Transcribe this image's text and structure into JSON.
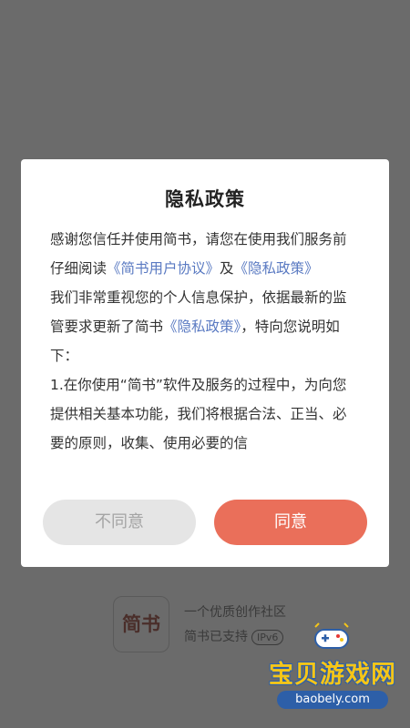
{
  "dialog": {
    "title": "隐私政策",
    "para1_a": "感谢您信任并使用简书，请您在使用我们服务前仔细阅读",
    "para1_link1": "《简书用户协议》",
    "para1_b": "及",
    "para1_link2": "《隐私政策》",
    "para2_a": " 我们非常重视您的个人信息保护，依据最新的监管要求更新了简书",
    "para2_link": "《隐私政策》",
    "para2_b": "，特向您说明如下：",
    "para3": " 1.在你使用“简书”软件及服务的过程中，为向您提供相关基本功能，我们将根据合法、正当、必要的原则，收集、使用必要的信",
    "disagree_label": "不同意",
    "agree_label": "同意"
  },
  "brand": {
    "logo_text": "简书",
    "slogan": "一个优质创作社区",
    "ipv6_text": "简书已支持",
    "ipv6_badge": "IPv6"
  },
  "watermark": {
    "icon": "gamepad-icon",
    "text": "宝贝游戏网",
    "url": "baobely.com"
  },
  "colors": {
    "accent": "#ea6f5a",
    "link": "#5a7ac2",
    "overlay": "#6b6b6b"
  }
}
